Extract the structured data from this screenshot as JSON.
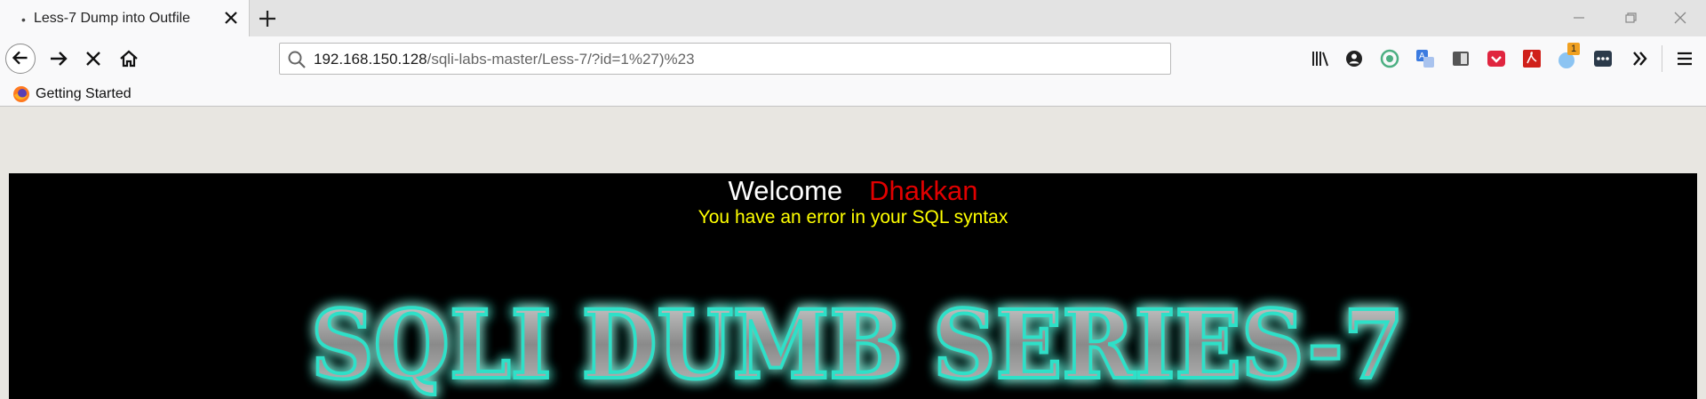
{
  "tab": {
    "title": "Less-7 Dump into Outfile",
    "dot": "•"
  },
  "address": {
    "host": "192.168.150.128",
    "path": "/sqli-labs-master/Less-7/?id=1%27)%23"
  },
  "bookmarks": [
    {
      "label": "Getting Started"
    }
  ],
  "toolbar": {
    "badge": "1"
  },
  "page": {
    "welcome": "Welcome",
    "name": "Dhakkan",
    "error": "You have an error in your SQL syntax",
    "banner": "SQLI DUMB SERIES-7"
  },
  "colors": {
    "welcome": "#ffffff",
    "name": "#e00000",
    "error": "#ffff00",
    "banner_glow": "#2de0c8"
  }
}
